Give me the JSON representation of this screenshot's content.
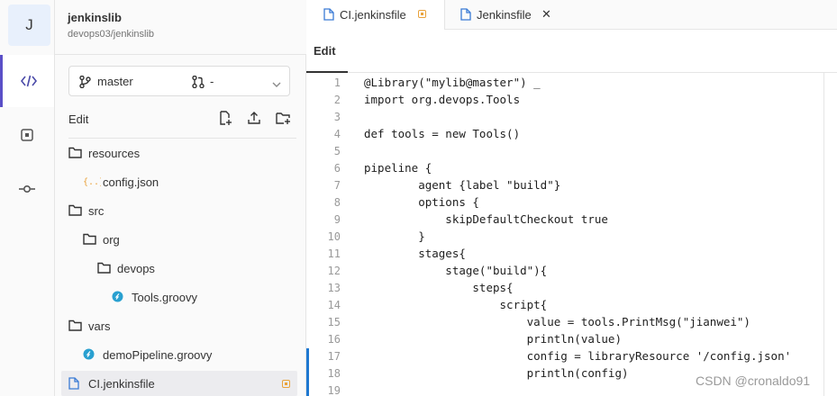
{
  "project": {
    "initial": "J",
    "name": "jenkinslib",
    "path": "devops03/jenkinslib"
  },
  "activity_bar": {
    "items": [
      {
        "name": "code-icon",
        "active": true
      },
      {
        "name": "review-icon",
        "active": false
      },
      {
        "name": "commit-icon",
        "active": false
      }
    ]
  },
  "branch_selector": {
    "branch": "master",
    "merge_request": "-"
  },
  "sidebar": {
    "edit_label": "Edit",
    "tree": [
      {
        "label": "resources",
        "type": "folder",
        "depth": 0
      },
      {
        "label": "config.json",
        "type": "json",
        "depth": 1
      },
      {
        "label": "src",
        "type": "folder",
        "depth": 0
      },
      {
        "label": "org",
        "type": "folder",
        "depth": 1
      },
      {
        "label": "devops",
        "type": "folder",
        "depth": 2
      },
      {
        "label": "Tools.groovy",
        "type": "groovy",
        "depth": 3
      },
      {
        "label": "vars",
        "type": "folder",
        "depth": 0
      },
      {
        "label": "demoPipeline.groovy",
        "type": "groovy",
        "depth": 1
      },
      {
        "label": "CI.jenkinsfile",
        "type": "file",
        "depth": 0,
        "active": true,
        "modified": true
      }
    ]
  },
  "tabs": [
    {
      "label": "CI.jenkinsfile",
      "active": true,
      "modified": true
    },
    {
      "label": "Jenkinsfile",
      "active": false,
      "close": "✕"
    }
  ],
  "editor": {
    "mode_tab": "Edit",
    "lines": [
      {
        "n": "1",
        "text": "@Library(\"mylib@master\") _"
      },
      {
        "n": "2",
        "text": "import org.devops.Tools"
      },
      {
        "n": "3",
        "text": ""
      },
      {
        "n": "4",
        "text": "def tools = new Tools()"
      },
      {
        "n": "5",
        "text": ""
      },
      {
        "n": "6",
        "text": "pipeline {"
      },
      {
        "n": "7",
        "text": "        agent {label \"build\"}"
      },
      {
        "n": "8",
        "text": "        options {"
      },
      {
        "n": "9",
        "text": "            skipDefaultCheckout true"
      },
      {
        "n": "10",
        "text": "        }"
      },
      {
        "n": "11",
        "text": "        stages{"
      },
      {
        "n": "12",
        "text": "            stage(\"build\"){"
      },
      {
        "n": "13",
        "text": "                steps{"
      },
      {
        "n": "14",
        "text": "                    script{"
      },
      {
        "n": "15",
        "text": "                        value = tools.PrintMsg(\"jianwei\")"
      },
      {
        "n": "16",
        "text": "                        println(value)"
      },
      {
        "n": "17",
        "text": "                        config = libraryResource '/config.json'"
      },
      {
        "n": "18",
        "text": "                        println(config)"
      },
      {
        "n": "19",
        "text": ""
      }
    ],
    "changed_lines": [
      "17",
      "18",
      "19"
    ]
  },
  "watermark": "CSDN @cronaldo91",
  "colors": {
    "accent": "#5a4fc7",
    "modified": "#e9a23b",
    "groovy": "#29a0d0",
    "json": "#e9a23b",
    "change_marker": "#1f78d1"
  }
}
